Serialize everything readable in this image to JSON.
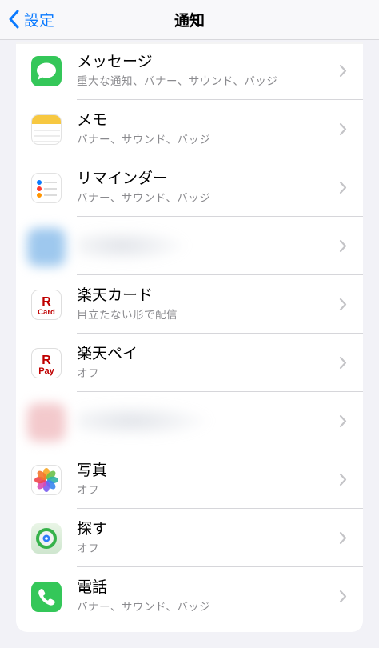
{
  "nav": {
    "back_label": "設定",
    "title": "通知"
  },
  "rows": [
    {
      "name": "メッセージ",
      "subtitle": "重大な通知、バナー、サウンド、バッジ",
      "icon": "messages-icon"
    },
    {
      "name": "メモ",
      "subtitle": "バナー、サウンド、バッジ",
      "icon": "notes-icon"
    },
    {
      "name": "リマインダー",
      "subtitle": "バナー、サウンド、バッジ",
      "icon": "reminders-icon"
    },
    {
      "name": "",
      "subtitle": "",
      "icon": "blurred-app-icon"
    },
    {
      "name": "楽天カード",
      "subtitle": "目立たない形で配信",
      "icon": "rakuten-card-icon"
    },
    {
      "name": "楽天ペイ",
      "subtitle": "オフ",
      "icon": "rakuten-pay-icon"
    },
    {
      "name": "",
      "subtitle": "",
      "icon": "blurred-app-icon"
    },
    {
      "name": "写真",
      "subtitle": "オフ",
      "icon": "photos-icon"
    },
    {
      "name": "探す",
      "subtitle": "オフ",
      "icon": "find-my-icon"
    },
    {
      "name": "電話",
      "subtitle": "バナー、サウンド、バッジ",
      "icon": "phone-icon"
    }
  ],
  "icon_labels": {
    "rakuten_r": "R",
    "rakuten_card": "Card",
    "rakuten_pay": "Pay"
  },
  "colors": {
    "accent": "#0a7aff",
    "messages": "#34c759",
    "phone": "#34c759",
    "rakuten": "#bf0000",
    "secondary_text": "#8a8a8e",
    "background": "#f2f2f7"
  }
}
